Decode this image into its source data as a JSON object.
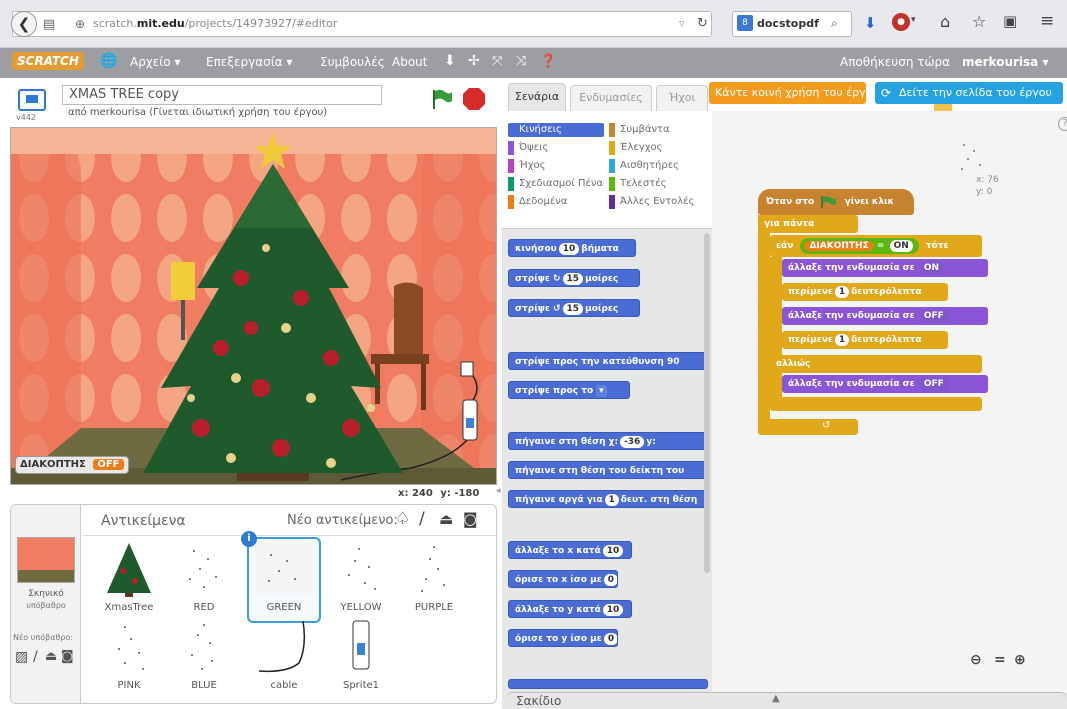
{
  "browser": {
    "url_prefix": "scratch.",
    "url_domain": "mit.edu",
    "url_path": "/projects/14973927/#editor",
    "search_text": "docstopdf"
  },
  "menubar": {
    "logo": "SCRATCH",
    "file": "Αρχείο ▾",
    "edit": "Επεξεργασία ▾",
    "tips": "Συμβουλές",
    "about": "About",
    "save_now": "Αποθήκευση τώρα",
    "username": "merkourisa ▾"
  },
  "stage": {
    "project_title": "XMAS TREE copy",
    "author_line": "από merkourisa (Γίνεται ιδιωτική χρήση του έργου)",
    "version": "v442",
    "var_monitor_name": "ΔΙΑΚΟΠΤΗΣ",
    "var_monitor_value": "OFF",
    "coords_x_label": "x:",
    "coords_x": "240",
    "coords_y_label": "y:",
    "coords_y": "-180"
  },
  "sprite_pane": {
    "title": "Αντικείμενα",
    "new_sprite_label": "Νέο αντικείμενο:",
    "stage_label": "Σκηνικό",
    "stage_count": "υπόβαθρο",
    "new_backdrop_label": "Νέο υπόβαθρο:",
    "sprites": [
      {
        "name": "XmasTree"
      },
      {
        "name": "RED"
      },
      {
        "name": "GREEN"
      },
      {
        "name": "YELLOW"
      },
      {
        "name": "PURPLE"
      },
      {
        "name": "PINK"
      },
      {
        "name": "BLUE"
      },
      {
        "name": "cable"
      },
      {
        "name": "Sprite1"
      }
    ]
  },
  "tabs": {
    "scripts": "Σενάρια",
    "costumes": "Ενδυμασίες",
    "sounds": "Ήχοι"
  },
  "share": {
    "share_button": "Κάντε κοινή χρήση του έργου",
    "see_page_button": "Δείτε την σελίδα του έργου"
  },
  "categories": [
    {
      "label": "Κινήσεις",
      "color": "#4a6cd4"
    },
    {
      "label": "Συμβάντα",
      "color": "#c88330"
    },
    {
      "label": "Όψεις",
      "color": "#8a55d7"
    },
    {
      "label": "Έλεγχος",
      "color": "#e1a91a"
    },
    {
      "label": "Ήχος",
      "color": "#bb42c3"
    },
    {
      "label": "Αισθητήρες",
      "color": "#2ca5e2"
    },
    {
      "label": "Σχεδιασμοί Πένας",
      "color": "#0e9a6c"
    },
    {
      "label": "Τελεστές",
      "color": "#5cb712"
    },
    {
      "label": "Δεδομένα",
      "color": "#ee7d16"
    },
    {
      "label": "Άλλες Εντολές",
      "color": "#632d99"
    }
  ],
  "palette_blocks": {
    "move_a": "κινήσου",
    "move_n": "10",
    "move_b": "βήματα",
    "turn_r_a": "στρίψε ↻",
    "turn_r_n": "15",
    "turn_r_b": "μοίρες",
    "turn_l_a": "στρίψε ↺",
    "turn_l_n": "15",
    "turn_l_b": "μοίρες",
    "point_dir": "στρίψε προς την κατεύθυνση 90",
    "point_to": "στρίψε προς το",
    "goto_xy_a": "πήγαινε στη θέση χ:",
    "goto_xy_n": "-36",
    "goto_xy_b": "y:",
    "goto_mouse": "πήγαινε στη θέση του δείκτη του",
    "glide_a": "πήγαινε αργά για",
    "glide_n": "1",
    "glide_b": "δευτ. στη θέση",
    "change_x_a": "άλλαξε το x κατά",
    "change_x_n": "10",
    "set_x_a": "όρισε το x ίσο με",
    "set_x_n": "0",
    "change_y_a": "άλλαξε το y κατά",
    "change_y_n": "10",
    "set_y_a": "όρισε το y ίσο με",
    "set_y_n": "0"
  },
  "script": {
    "hat_a": "Όταν στο",
    "hat_b": "γίνει κλικ",
    "forever": "για πάντα",
    "if_label": "εάν",
    "if_var": "ΔΙΑΚΟΠΤΗΣ",
    "if_eq": "=",
    "if_value": "ON",
    "if_then": "τότε",
    "switch_on_label": "άλλαξε την ενδυμασία σε",
    "switch_on_value": "ON",
    "wait1_label": "περίμενε",
    "wait1_value": "1",
    "wait1_unit": "δευτερόλεπτα",
    "switch_off_label": "άλλαξε την ενδυμασία σε",
    "switch_off_value": "OFF",
    "wait2_label": "περίμενε",
    "wait2_value": "1",
    "wait2_unit": "δευτερόλεπτα",
    "else_label": "αλλιώς",
    "switch_off2_label": "άλλαξε την ενδυμασία σε",
    "switch_off2_value": "OFF",
    "sprite_info_x": "x: 76",
    "sprite_info_y": "y: 0"
  },
  "backpack": {
    "label": "Σακίδιο"
  }
}
